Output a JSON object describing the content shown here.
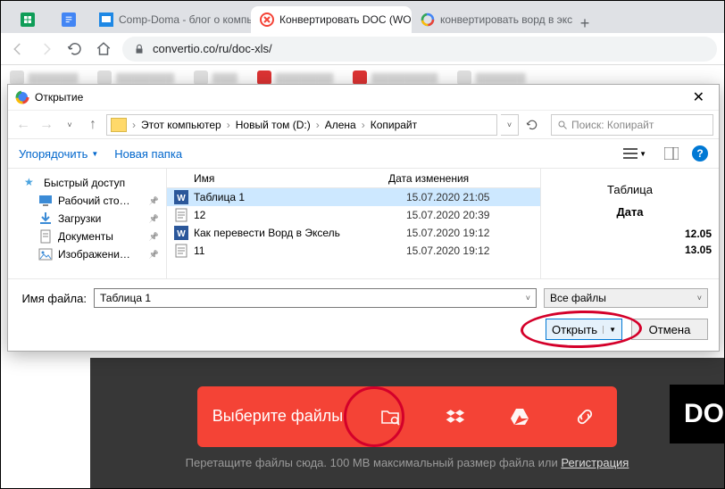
{
  "browser": {
    "tabs": [
      {
        "title": "",
        "icon": "sheets"
      },
      {
        "title": "",
        "icon": "docs"
      },
      {
        "title": "Comp-Doma - блог о компьюте",
        "icon": "compdoma"
      },
      {
        "title": "Конвертировать DOC (WORD) в",
        "icon": "convertio",
        "active": true
      },
      {
        "title": "конвертировать ворд в эксель",
        "icon": "google"
      }
    ],
    "url": "convertio.co/ru/doc-xls/"
  },
  "dialog": {
    "title": "Открытие",
    "breadcrumb": [
      "Этот компьютер",
      "Новый том (D:)",
      "Алена",
      "Копирайт"
    ],
    "search_placeholder": "Поиск: Копирайт",
    "toolbar": {
      "organize": "Упорядочить",
      "newfolder": "Новая папка"
    },
    "sidebar": [
      {
        "label": "Быстрый доступ",
        "icon": "star"
      },
      {
        "label": "Рабочий сто…",
        "icon": "desktop",
        "pinned": true
      },
      {
        "label": "Загрузки",
        "icon": "downloads",
        "pinned": true
      },
      {
        "label": "Документы",
        "icon": "documents",
        "pinned": true
      },
      {
        "label": "Изображени…",
        "icon": "pictures",
        "pinned": true
      }
    ],
    "columns": {
      "name": "Имя",
      "date": "Дата изменения"
    },
    "files": [
      {
        "name": "Таблица 1",
        "date": "15.07.2020 21:05",
        "type": "word",
        "selected": true
      },
      {
        "name": "12",
        "date": "15.07.2020 20:39",
        "type": "doc"
      },
      {
        "name": "Как перевести Ворд в Эксель",
        "date": "15.07.2020 19:12",
        "type": "word"
      },
      {
        "name": "11",
        "date": "15.07.2020 19:12",
        "type": "doc"
      }
    ],
    "preview": {
      "h1": "Таблица",
      "h2": "Дата",
      "r1": "12.05",
      "r2": "13.05"
    },
    "filename_label": "Имя файла:",
    "filename_value": "Таблица 1",
    "filter": "Все файлы",
    "open": "Открыть",
    "cancel": "Отмена"
  },
  "page": {
    "select_files": "Выберите файлы",
    "hint_prefix": "Перетащите файлы сюда. 100 MB максимальный размер файла или ",
    "hint_link": "Регистрация",
    "dotag": "DO"
  }
}
